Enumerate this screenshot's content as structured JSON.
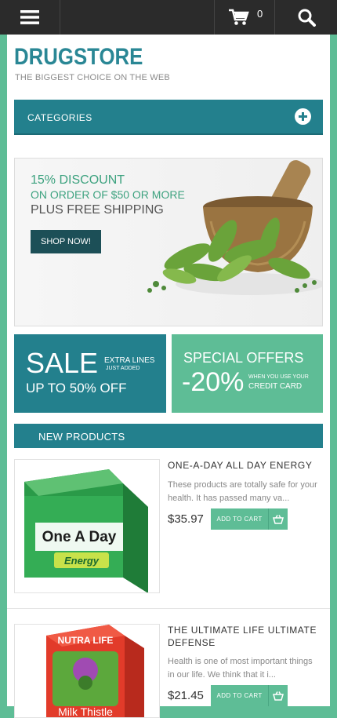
{
  "topbar": {
    "cart_count": "0"
  },
  "brand": {
    "logo": "DRUGSTORE",
    "tagline": "THE BIGGEST CHOICE ON THE WEB"
  },
  "categories": {
    "label": "CATEGORIES"
  },
  "banner": {
    "line1": "15% DISCOUNT",
    "line2": "ON ORDER OF $50 OR MORE",
    "line3": "PLUS FREE SHIPPING",
    "button": "SHOP NOW!"
  },
  "promo_sale": {
    "big": "SALE",
    "small1": "EXTRA LINES",
    "small2": "JUST ADDED",
    "sub": "UP TO 50% OFF"
  },
  "promo_offers": {
    "title": "SPECIAL OFFERS",
    "big": "-20%",
    "small1": "WHEN YOU USE YOUR",
    "small2": "CREDIT CARD"
  },
  "new_products": {
    "label": "NEW PRODUCTS",
    "items": [
      {
        "title": "ONE-A-DAY ALL DAY ENERGY",
        "desc": "These products are totally safe for your health. It has passed many va...",
        "price": "$35.97",
        "cart": "ADD TO CART",
        "box_brand": "One A Day",
        "box_sub": "Energy"
      },
      {
        "title": "THE ULTIMATE LIFE ULTIMATE DEFENSE",
        "desc": "Health is one of most important things in our life. We think that it i...",
        "price": "$21.45",
        "cart": "ADD TO CART",
        "box_brand": "NUTRA LIFE",
        "box_sub": "Milk Thistle"
      }
    ]
  },
  "colors": {
    "teal": "#23808d",
    "mint": "#5ebd96",
    "dark": "#2b2b2b"
  }
}
